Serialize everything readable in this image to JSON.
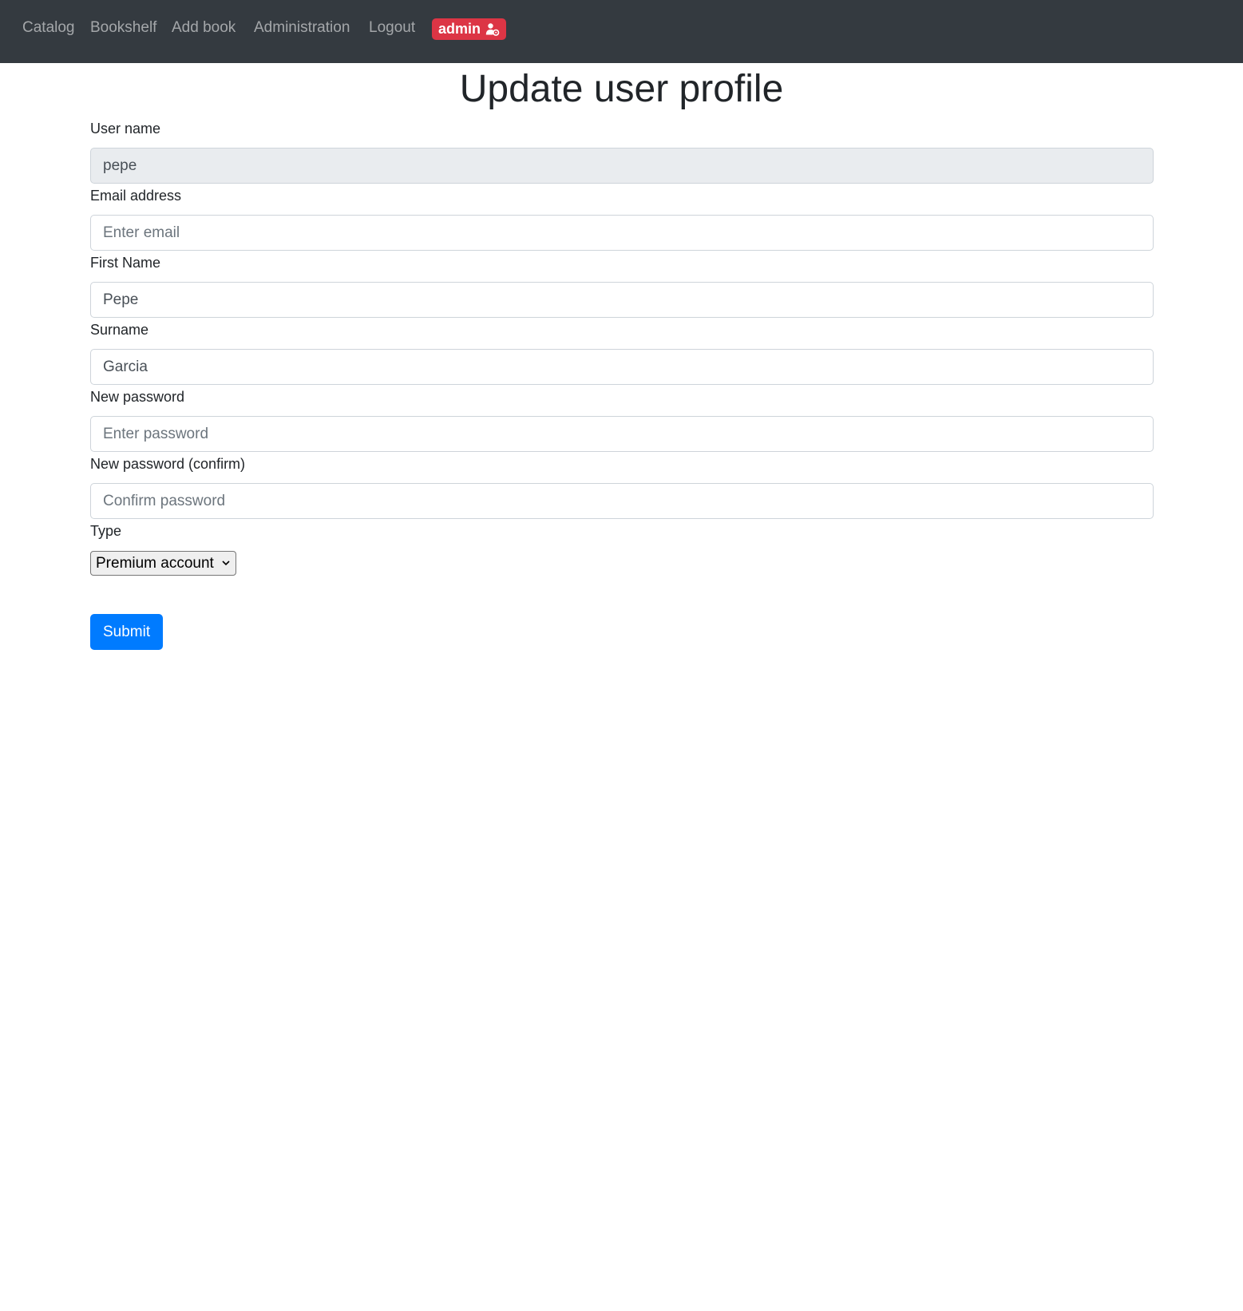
{
  "navbar": {
    "links": [
      {
        "label": "Catalog"
      },
      {
        "label": "Bookshelf"
      },
      {
        "label": "Add book"
      },
      {
        "label": "Administration"
      },
      {
        "label": "Logout"
      }
    ],
    "user_badge": {
      "label": "admin",
      "icon": "user-gear-icon",
      "color": "#dc3545"
    },
    "background": "#343a40"
  },
  "page": {
    "title": "Update user profile"
  },
  "form": {
    "username": {
      "label": "User name",
      "value": "pepe"
    },
    "email": {
      "label": "Email address",
      "value": "",
      "placeholder": "Enter email"
    },
    "first_name": {
      "label": "First Name",
      "value": "Pepe"
    },
    "surname": {
      "label": "Surname",
      "value": "Garcia"
    },
    "new_password": {
      "label": "New password",
      "value": "",
      "placeholder": "Enter password"
    },
    "confirm_password": {
      "label": "New password (confirm)",
      "value": "",
      "placeholder": "Confirm password"
    },
    "type": {
      "label": "Type",
      "selected": "Premium account",
      "icon": "chevron-down-icon"
    },
    "submit": {
      "label": "Submit",
      "color": "#007bff"
    }
  }
}
